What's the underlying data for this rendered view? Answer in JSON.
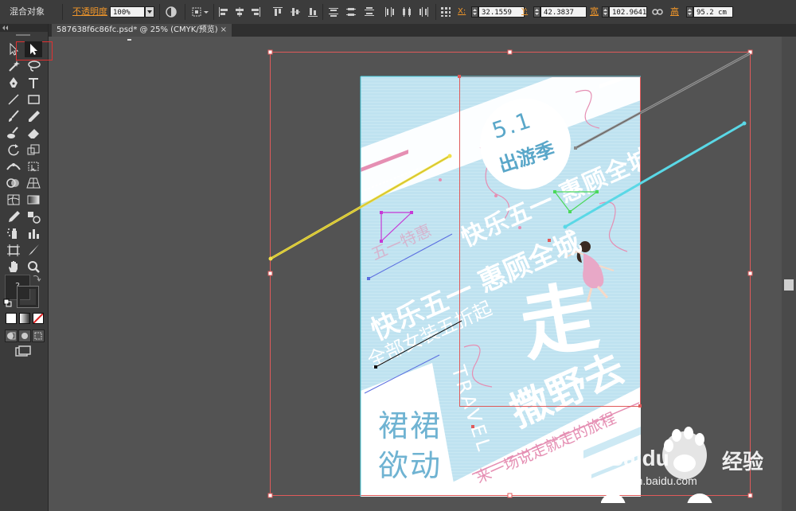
{
  "control_bar": {
    "object_type": "混合对象",
    "opacity_label": "不透明度",
    "opacity_value": "100%",
    "x_label": "X:",
    "x_value": "32.1559",
    "y_label": "Y:",
    "y_value": "42.3837",
    "width_label": "宽",
    "width_value": "102.9641",
    "height_label": "高",
    "height_value": "95.2 cm",
    "icons": [
      "recolor-icon",
      "align-icon",
      "align-left-icon",
      "align-hcenter-icon",
      "align-right-icon",
      "align-top-icon",
      "align-vcenter-icon",
      "align-bottom-icon",
      "distribute-top-icon",
      "distribute-vcenter-icon",
      "distribute-bottom-icon",
      "distribute-left-icon",
      "distribute-hcenter-icon",
      "distribute-right-icon",
      "transform-icon",
      "link-proportions-icon"
    ]
  },
  "document_tab": {
    "title": "587638f6c86fc.psd* @ 25% (CMYK/预览)",
    "close": "×"
  },
  "toolbar": {
    "selected_tool": "direct-selection-tool",
    "help_glyph": "?",
    "tools": [
      "selection-tool",
      "direct-selection-tool",
      "magic-wand-tool",
      "lasso-tool",
      "pen-tool",
      "type-tool",
      "line-tool",
      "rectangle-tool",
      "paintbrush-tool",
      "pencil-tool",
      "blob-brush-tool",
      "eraser-tool",
      "rotate-tool",
      "scale-tool",
      "width-tool",
      "free-transform-tool",
      "shape-builder-tool",
      "perspective-grid-tool",
      "mesh-tool",
      "gradient-tool",
      "eyedropper-tool",
      "blend-tool",
      "symbol-sprayer-tool",
      "column-graph-tool",
      "artboard-tool",
      "slice-tool",
      "hand-tool",
      "zoom-tool"
    ]
  },
  "poster": {
    "date_badge": "5.1",
    "season": "出游季",
    "headline": "快乐五一 惠顾全城",
    "tagline": "五一特惠",
    "subline": "全部女装五折起",
    "big_char": "走",
    "big_phrase": "撒野去",
    "travel": "TRAVEL",
    "slogan": "来一场说走就走的旅程",
    "corner_text_1": "裙裙",
    "corner_text_2": "欲动"
  },
  "watermark": {
    "brand": "Baidu",
    "brand_cn": "经验",
    "url": "jingyan.baidu.com"
  }
}
